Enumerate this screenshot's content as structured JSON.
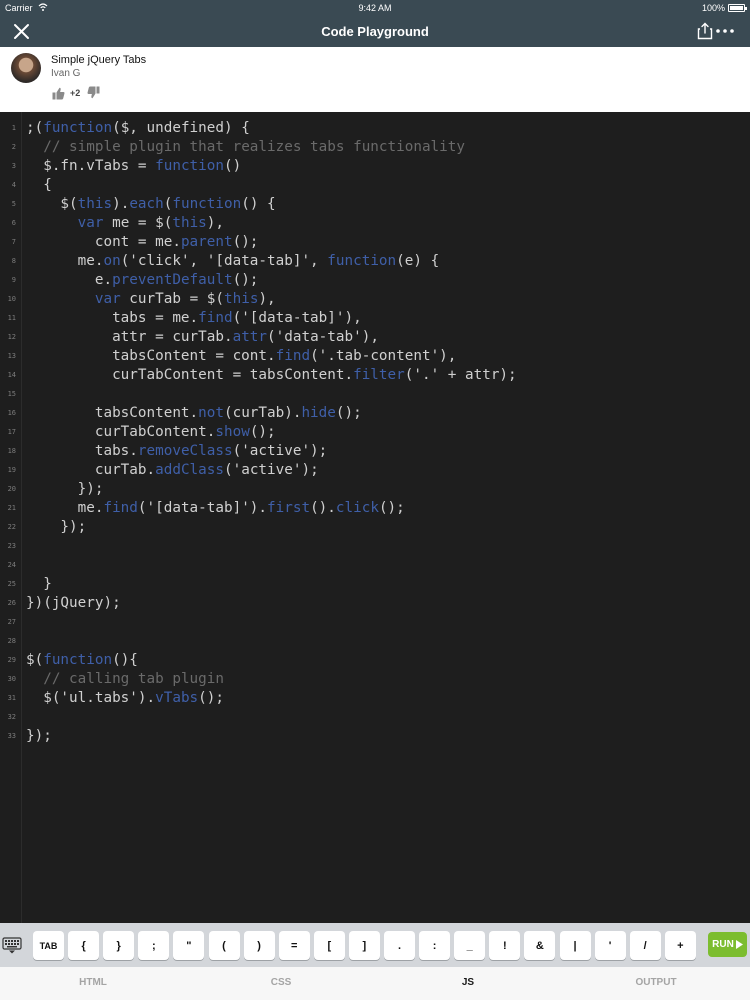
{
  "status_bar": {
    "carrier": "Carrier",
    "time": "9:42 AM",
    "battery": "100%"
  },
  "header": {
    "title": "Code Playground",
    "close_icon": "close-icon",
    "share_icon": "share-icon",
    "more_icon": "more-icon"
  },
  "code_info": {
    "title": "Simple jQuery Tabs",
    "author": "Ivan G",
    "votes": "+2"
  },
  "editor": {
    "lines": [
      [
        {
          "t": ";("
        },
        {
          "t": "function",
          "k": 1
        },
        {
          "t": "($, undefined) {"
        }
      ],
      [
        {
          "t": "  "
        },
        {
          "t": "// simple plugin that realizes tabs functionality",
          "c": 1
        }
      ],
      [
        {
          "t": "  $.fn.vTabs = "
        },
        {
          "t": "function",
          "k": 1
        },
        {
          "t": "()"
        }
      ],
      [
        {
          "t": "  {"
        }
      ],
      [
        {
          "t": "    $("
        },
        {
          "t": "this",
          "k": 1
        },
        {
          "t": ")."
        },
        {
          "t": "each",
          "k": 1
        },
        {
          "t": "("
        },
        {
          "t": "function",
          "k": 1
        },
        {
          "t": "() {"
        }
      ],
      [
        {
          "t": "      "
        },
        {
          "t": "var",
          "k": 1
        },
        {
          "t": " me = $("
        },
        {
          "t": "this",
          "k": 1
        },
        {
          "t": "),"
        }
      ],
      [
        {
          "t": "        cont = me."
        },
        {
          "t": "parent",
          "k": 1
        },
        {
          "t": "();"
        }
      ],
      [
        {
          "t": "      me."
        },
        {
          "t": "on",
          "k": 1
        },
        {
          "t": "('click', '[data-tab]', "
        },
        {
          "t": "function",
          "k": 1
        },
        {
          "t": "(e) {"
        }
      ],
      [
        {
          "t": "        e."
        },
        {
          "t": "preventDefault",
          "k": 1
        },
        {
          "t": "();"
        }
      ],
      [
        {
          "t": "        "
        },
        {
          "t": "var",
          "k": 1
        },
        {
          "t": " curTab = $("
        },
        {
          "t": "this",
          "k": 1
        },
        {
          "t": "),"
        }
      ],
      [
        {
          "t": "          tabs = me."
        },
        {
          "t": "find",
          "k": 1
        },
        {
          "t": "('[data-tab]'),"
        }
      ],
      [
        {
          "t": "          attr = curTab."
        },
        {
          "t": "attr",
          "k": 1
        },
        {
          "t": "('data-tab'),"
        }
      ],
      [
        {
          "t": "          tabsContent = cont."
        },
        {
          "t": "find",
          "k": 1
        },
        {
          "t": "('.tab-content'),"
        }
      ],
      [
        {
          "t": "          curTabContent = tabsContent."
        },
        {
          "t": "filter",
          "k": 1
        },
        {
          "t": "('.' + attr);"
        }
      ],
      [],
      [
        {
          "t": "        tabsContent."
        },
        {
          "t": "not",
          "k": 1
        },
        {
          "t": "(curTab)."
        },
        {
          "t": "hide",
          "k": 1
        },
        {
          "t": "();"
        }
      ],
      [
        {
          "t": "        curTabContent."
        },
        {
          "t": "show",
          "k": 1
        },
        {
          "t": "();"
        }
      ],
      [
        {
          "t": "        tabs."
        },
        {
          "t": "removeClass",
          "k": 1
        },
        {
          "t": "('active');"
        }
      ],
      [
        {
          "t": "        curTab."
        },
        {
          "t": "addClass",
          "k": 1
        },
        {
          "t": "('active');"
        }
      ],
      [
        {
          "t": "      });"
        }
      ],
      [
        {
          "t": "      me."
        },
        {
          "t": "find",
          "k": 1
        },
        {
          "t": "('[data-tab]')."
        },
        {
          "t": "first",
          "k": 1
        },
        {
          "t": "()."
        },
        {
          "t": "click",
          "k": 1
        },
        {
          "t": "();"
        }
      ],
      [
        {
          "t": "    });"
        }
      ],
      [],
      [],
      [
        {
          "t": "  }"
        }
      ],
      [
        {
          "t": "})(jQuery);"
        }
      ],
      [],
      [],
      [
        {
          "t": "$("
        },
        {
          "t": "function",
          "k": 1
        },
        {
          "t": "(){"
        }
      ],
      [
        {
          "t": "  "
        },
        {
          "t": "// calling tab plugin",
          "c": 1
        }
      ],
      [
        {
          "t": "  $('ul.tabs')."
        },
        {
          "t": "vTabs",
          "k": 1
        },
        {
          "t": "();"
        }
      ],
      [],
      [
        {
          "t": "});"
        }
      ]
    ]
  },
  "keyboard_bar": {
    "keys": [
      "TAB",
      "{",
      "}",
      ";",
      "\"",
      "(",
      ")",
      "=",
      "[",
      "]",
      ".",
      ":",
      "_",
      "!",
      "&",
      "|",
      "'",
      "/",
      "+"
    ],
    "run_label": "RUN"
  },
  "bottom_tabs": [
    "HTML",
    "CSS",
    "JS",
    "OUTPUT"
  ],
  "active_tab": "JS",
  "colors": {
    "header_bg": "#3a4a53",
    "editor_bg": "#1e1e1e",
    "keyword": "#3f5fa8",
    "comment": "#6a6a6a",
    "run_green": "#7cbd2f"
  }
}
